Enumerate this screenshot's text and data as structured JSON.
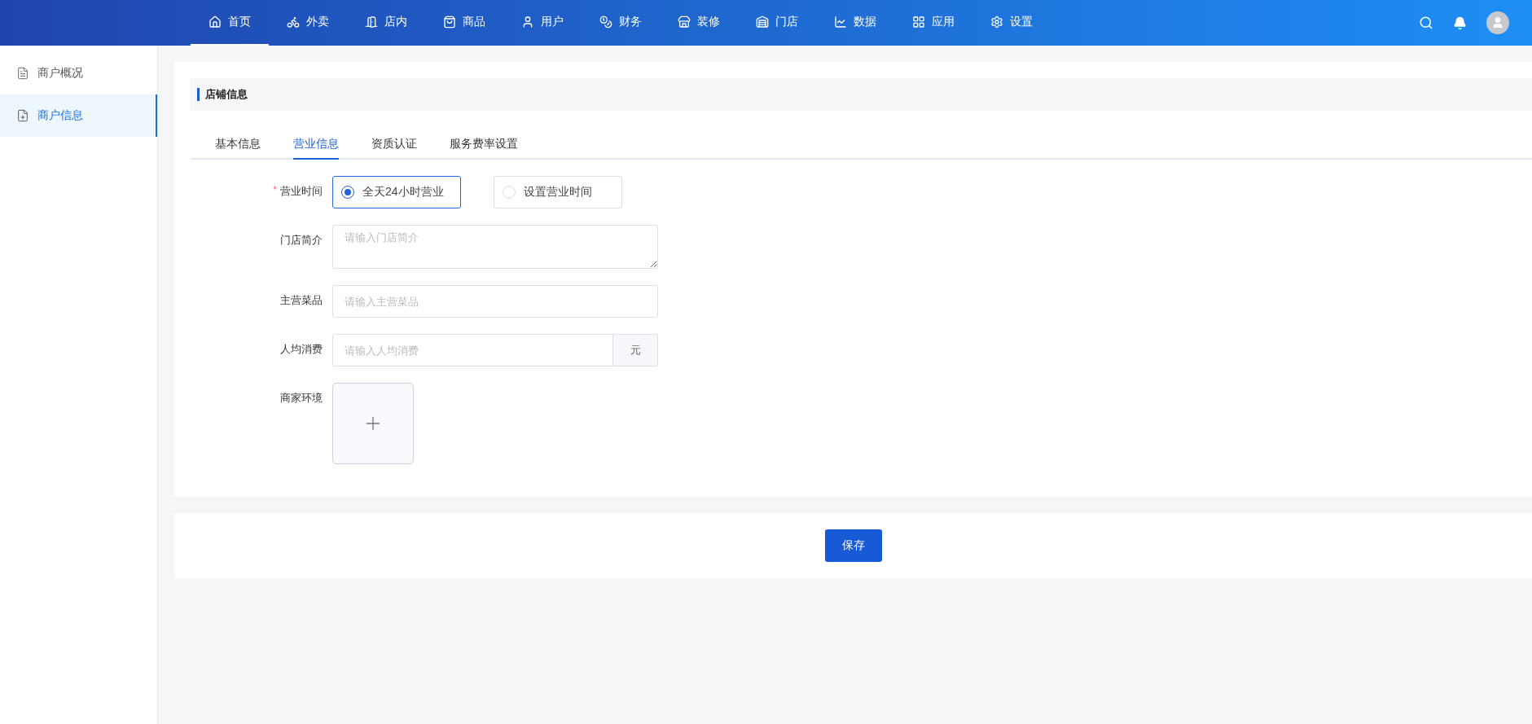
{
  "nav": [
    {
      "label": "首页",
      "selected": true
    },
    {
      "label": "外卖",
      "selected": false
    },
    {
      "label": "店内",
      "selected": false
    },
    {
      "label": "商品",
      "selected": false
    },
    {
      "label": "用户",
      "selected": false
    },
    {
      "label": "财务",
      "selected": false
    },
    {
      "label": "装修",
      "selected": false
    },
    {
      "label": "门店",
      "selected": false
    },
    {
      "label": "数据",
      "selected": false
    },
    {
      "label": "应用",
      "selected": false
    },
    {
      "label": "设置",
      "selected": false
    }
  ],
  "sidebar": {
    "items": [
      {
        "label": "商户概况",
        "selected": false
      },
      {
        "label": "商户信息",
        "selected": true
      }
    ]
  },
  "section_title": "店铺信息",
  "tabs": [
    {
      "label": "基本信息",
      "selected": false
    },
    {
      "label": "营业信息",
      "selected": true
    },
    {
      "label": "资质认证",
      "selected": false
    },
    {
      "label": "服务费率设置",
      "selected": false
    }
  ],
  "form": [
    {
      "kind": "radio",
      "label": "营业时间",
      "required_mark": "*",
      "options": [
        {
          "label": "全天24小时营业",
          "selected": true
        },
        {
          "label": "设置营业时间",
          "selected": false
        }
      ]
    },
    {
      "kind": "textarea",
      "label": "门店简介",
      "placeholder": "请输入门店简介"
    },
    {
      "kind": "input",
      "label": "主营菜品",
      "placeholder": "请输入主营菜品"
    },
    {
      "kind": "input",
      "label": "人均消费",
      "placeholder": "请输入人均消费",
      "suffix": "元"
    },
    {
      "kind": "upload",
      "label": "商家环境"
    }
  ],
  "save_button": "保存"
}
